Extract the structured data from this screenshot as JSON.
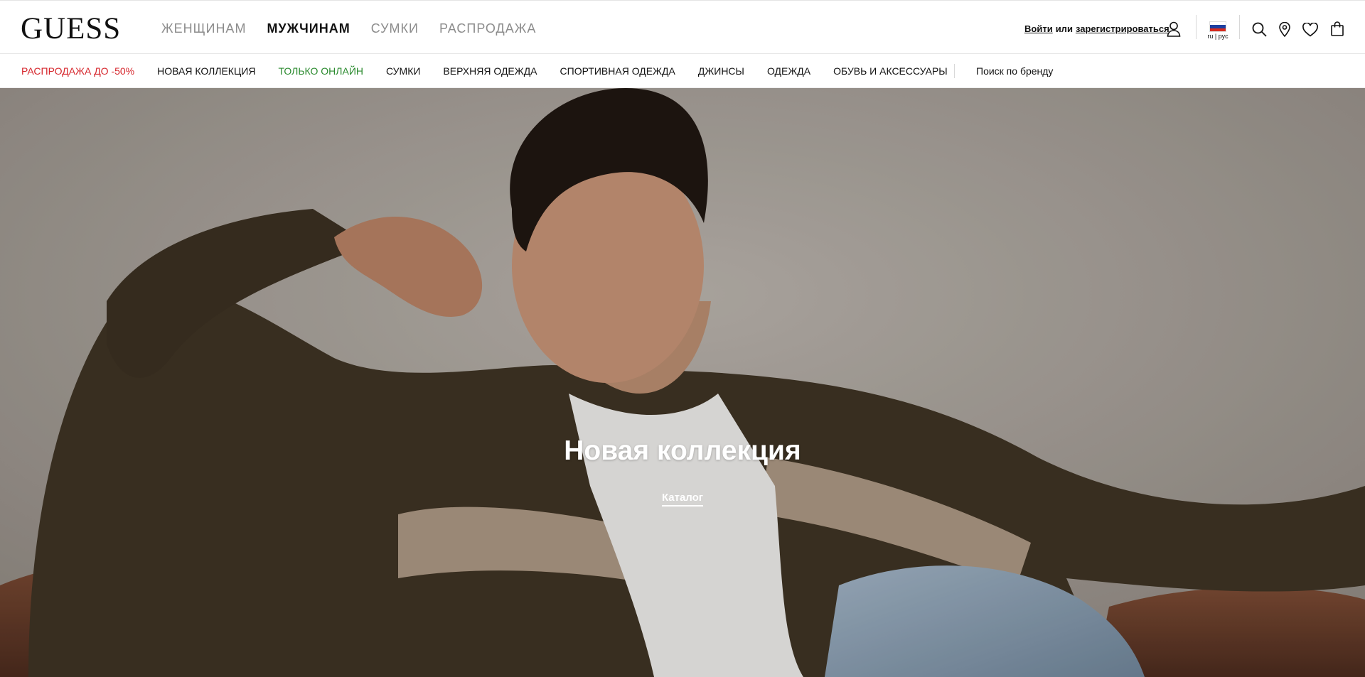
{
  "header": {
    "logo": "GUESS",
    "main_nav": [
      {
        "label": "ЖЕНЩИНАМ",
        "active": false
      },
      {
        "label": "МУЖЧИНАМ",
        "active": true
      },
      {
        "label": "СУМКИ",
        "active": false
      },
      {
        "label": "РАСПРОДАЖА",
        "active": false
      }
    ],
    "auth": {
      "login": "Войти",
      "or": "или",
      "register": "зарегистрироваться"
    },
    "language": {
      "label": "ru | рус",
      "flag": "russia-flag"
    },
    "icons": [
      "user-icon",
      "search-icon",
      "location-pin-icon",
      "heart-icon",
      "shopping-bag-icon"
    ]
  },
  "sub_nav": {
    "items": [
      {
        "label": "РАСПРОДАЖА ДО -50%",
        "style": "sale"
      },
      {
        "label": "НОВАЯ КОЛЛЕКЦИЯ",
        "style": "normal"
      },
      {
        "label": "ТОЛЬКО ОНЛАЙН",
        "style": "online"
      },
      {
        "label": "СУМКИ",
        "style": "normal"
      },
      {
        "label": "ВЕРХНЯЯ ОДЕЖДА",
        "style": "normal"
      },
      {
        "label": "СПОРТИВНАЯ ОДЕЖДА",
        "style": "normal"
      },
      {
        "label": "ДЖИНСЫ",
        "style": "normal"
      },
      {
        "label": "ОДЕЖДА",
        "style": "normal"
      },
      {
        "label": "ОБУВЬ И АКСЕССУАРЫ",
        "style": "normal"
      }
    ],
    "brand_search": "Поиск по бренду"
  },
  "hero": {
    "title": "Новая коллекция",
    "link": "Каталог"
  },
  "colors": {
    "sale": "#d6262c",
    "online": "#2a8a2e",
    "text": "#111111",
    "inactive_nav": "#8c8c8c"
  }
}
